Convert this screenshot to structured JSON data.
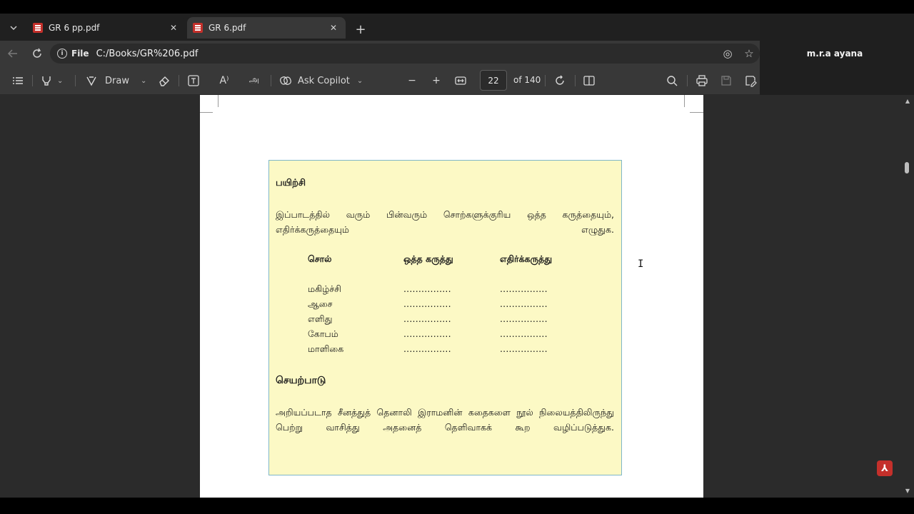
{
  "tabs": [
    {
      "title": "GR 6 pp.pdf",
      "active": false
    },
    {
      "title": "GR 6.pdf",
      "active": true
    }
  ],
  "address": {
    "scheme": "File",
    "url": "C:/Books/GR%206.pdf"
  },
  "toolbar": {
    "draw_label": "Draw",
    "copilot_label": "Ask Copilot",
    "page_current": "22",
    "page_total": "of 140"
  },
  "user": {
    "name": "m.r.a ayana"
  },
  "exercise": {
    "heading": "பயிற்சி",
    "instruction": "இப்பாடத்தில் வரும் பின்வரும் சொற்களுக்குரிய ஒத்த கருத்தையும், எதிர்க்கருத்தையும் எழுதுக.",
    "columns": [
      "சொல்",
      "ஒத்த கருத்து",
      "எதிர்க்கருத்து"
    ],
    "words": [
      "மகிழ்ச்சி",
      "ஆசை",
      "எளிது",
      "கோபம்",
      "மாளிகை"
    ],
    "blank": "................",
    "activity_heading": "செயற்பாடு",
    "activity_text": "அறியப்படாத சீனத்துத் தெனாலி இராமனின் கதைகளை நூல் நிலையத்திலிருந்து பெற்று வாசித்து அதனைத் தெளிவாகக் கூற வழிப்படுத்துக."
  },
  "icons": {
    "tab_list": "chevron-down-icon",
    "new_tab": "plus-icon",
    "back": "back-arrow-icon",
    "refresh": "refresh-icon",
    "contents": "table-of-contents-icon",
    "highlight": "highlighter-icon",
    "erase": "eraser-icon",
    "text": "add-text-icon",
    "read_aloud": "read-aloud-icon",
    "translate": "translate-icon",
    "zoom_out": "minus-icon",
    "zoom_in": "plus-icon",
    "fit": "fit-page-icon",
    "rotate": "rotate-icon",
    "page_view": "page-view-icon",
    "search": "search-icon",
    "print": "print-icon",
    "save": "save-icon",
    "save_as": "save-as-icon"
  },
  "colors": {
    "exercise_bg": "#fcf9c5",
    "exercise_border": "#7fb7c9",
    "pdf_red": "#c4302b"
  }
}
